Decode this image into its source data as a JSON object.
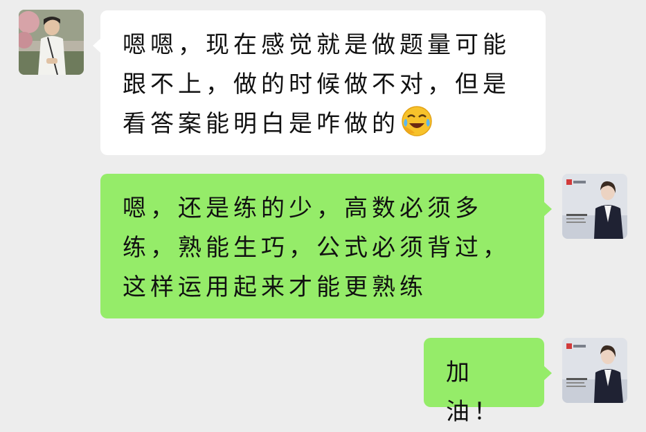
{
  "messages": [
    {
      "side": "left",
      "text": "嗯嗯，现在感觉就是做题量可能跟不上，做的时候做不对，但是看答案能明白是咋做的",
      "emoji": "face-with-tears-of-joy-icon"
    },
    {
      "side": "right",
      "text": "嗯，还是练的少，高数必须多练，熟能生巧，公式必须背过，这样运用起来才能更熟练"
    },
    {
      "side": "right",
      "text": "加油！"
    }
  ],
  "colors": {
    "background": "#ededed",
    "incoming_bubble": "#ffffff",
    "outgoing_bubble": "#95ec69"
  }
}
